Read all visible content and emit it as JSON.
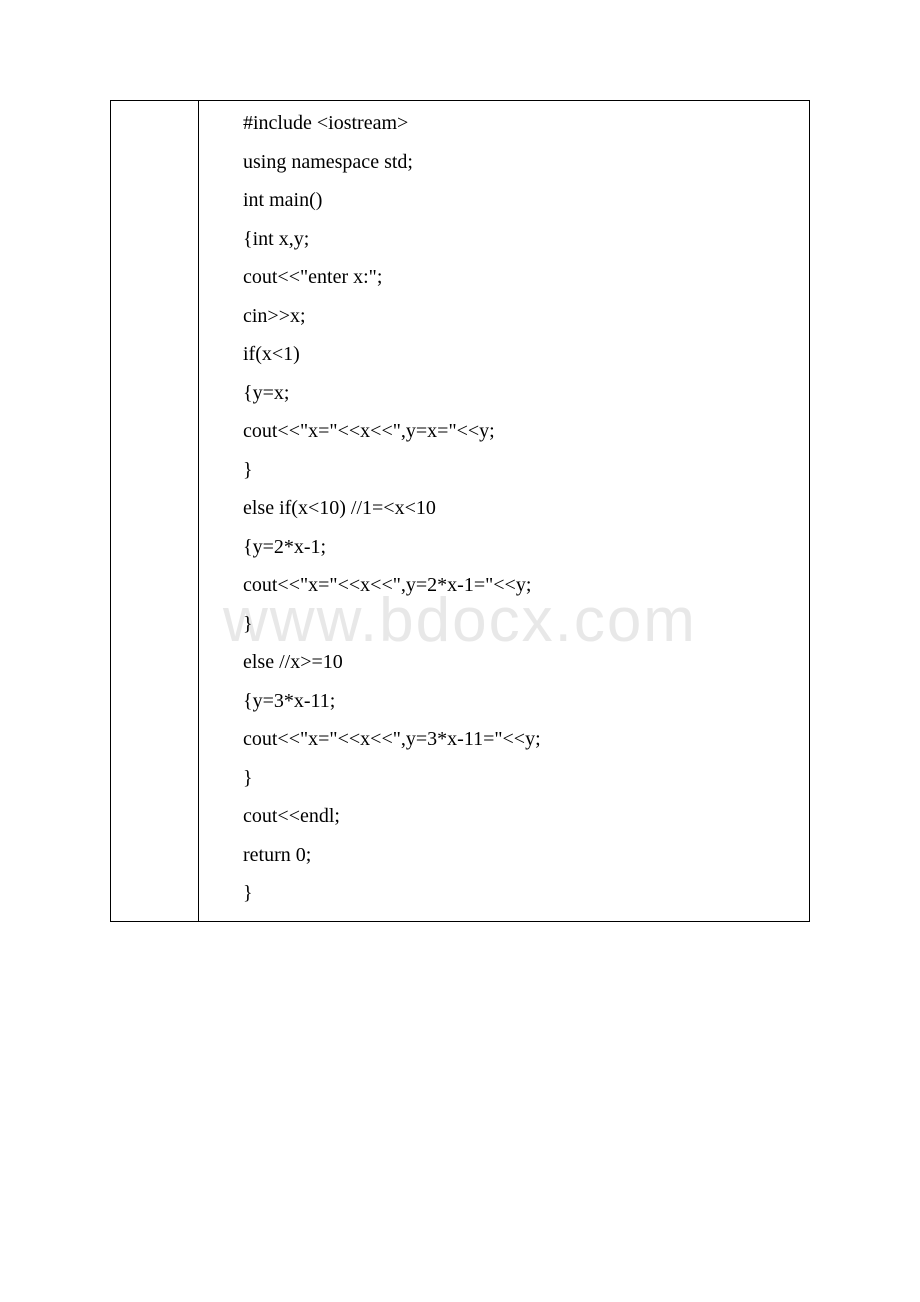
{
  "watermark": "www.bdocx.com",
  "code": {
    "lines": [
      "#include <iostream>",
      "using namespace std;",
      "int main()",
      "{int x,y;",
      "cout<<\"enter x:\";",
      "cin>>x;",
      "if(x<1)",
      "{y=x;",
      "cout<<\"x=\"<<x<<\",y=x=\"<<y;",
      "}",
      "else if(x<10) //1=<x<10",
      "{y=2*x-1;",
      "cout<<\"x=\"<<x<<\",y=2*x-1=\"<<y;",
      "}",
      "else //x>=10",
      "{y=3*x-11;",
      "cout<<\"x=\"<<x<<\",y=3*x-11=\"<<y;",
      "}",
      "cout<<endl;",
      "return 0;",
      "}"
    ]
  }
}
